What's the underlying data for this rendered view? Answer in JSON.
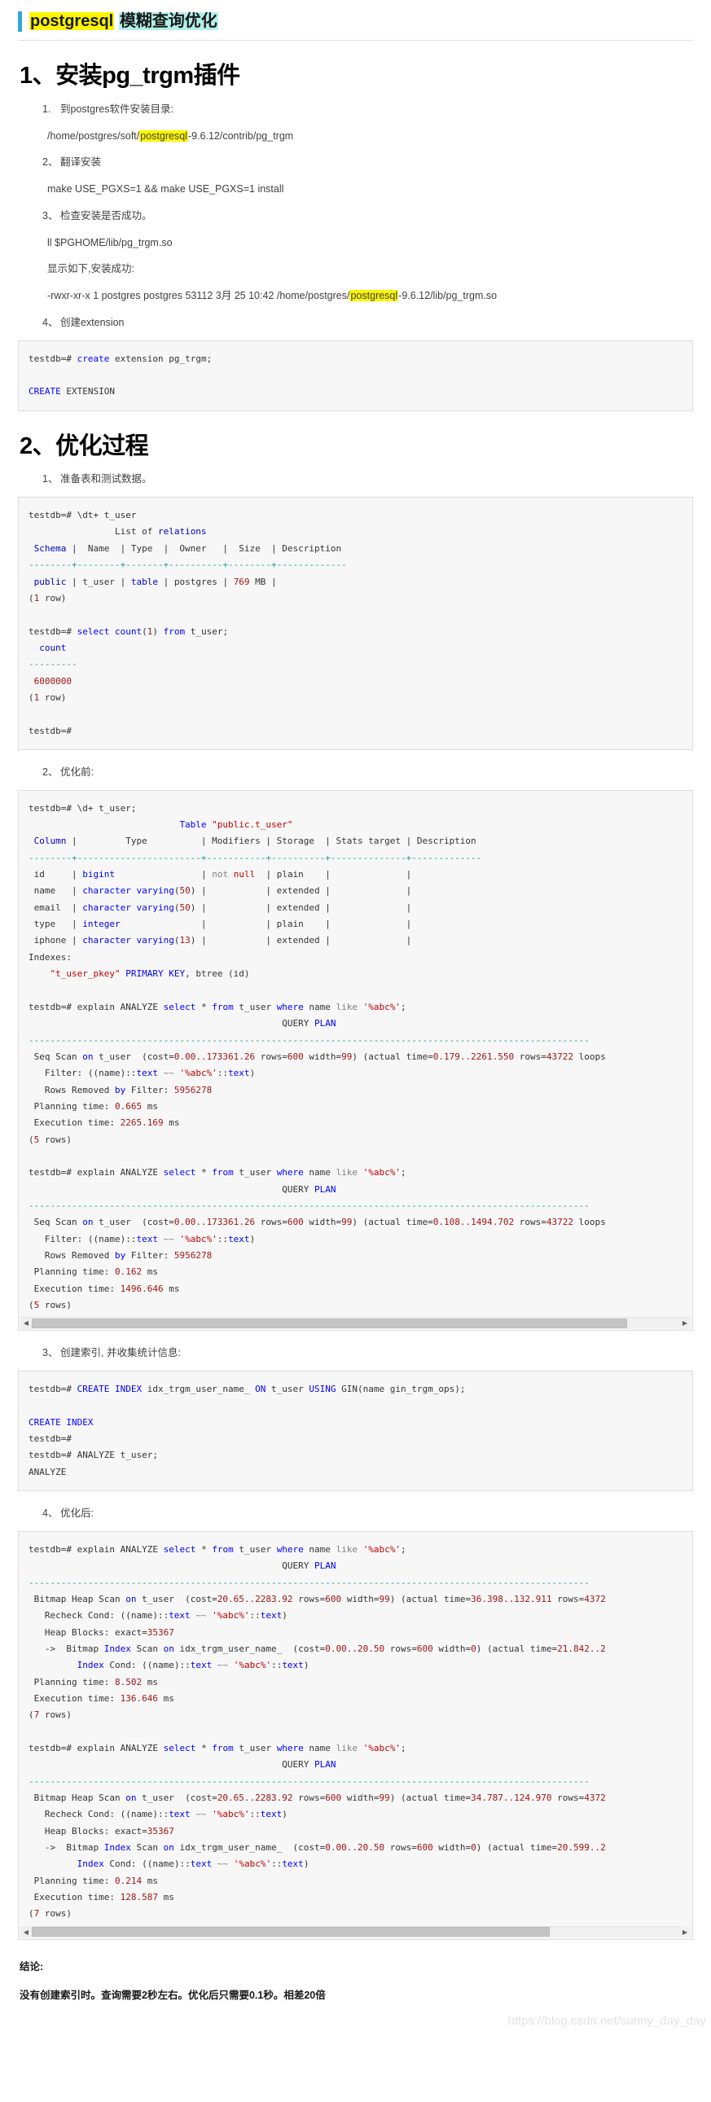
{
  "document": {
    "title_parts": {
      "highlight_yellow": "postgresql",
      "highlight_cyan": "模糊查询优化"
    },
    "accent_color": "#2fa8e0",
    "highlight_yellow_color": "#fdf500",
    "highlight_cyan_color": "#b3f0ea"
  },
  "sections": [
    {
      "heading": "1、安装pg_trgm插件",
      "steps": [
        {
          "num": "1.",
          "label": "到postgres软件安装目录:"
        },
        {
          "num": "2、",
          "label": "翻译安装"
        },
        {
          "num": "3、",
          "label": "检查安装是否成功。"
        },
        {
          "num": "4、",
          "label": "创建extension"
        }
      ],
      "detail_path_prefix": "/home/postgres/soft/",
      "detail_path_hl": "postgresql",
      "detail_path_suffix": "-9.6.12/contrib/pg_trgm",
      "detail_make": "make USE_PGXS=1  && make USE_PGXS=1 install",
      "detail_ll": "ll $PGHOME/lib/pg_trgm.so",
      "detail_show_label": "显示如下,安装成功:",
      "detail_ls_prefix": "-rwxr-xr-x 1 postgres postgres 53112 3月  25 10:42 /home/postgres/",
      "detail_ls_hl": "postgresql",
      "detail_ls_suffix": "-9.6.12/lib/pg_trgm.so"
    },
    {
      "heading": "2、优化过程",
      "steps": [
        {
          "num": "1、",
          "label": "准备表和测试数据。"
        },
        {
          "num": "2、",
          "label": "优化前:"
        },
        {
          "num": "3、",
          "label": "创建索引, 并收集统计信息:"
        },
        {
          "num": "4、",
          "label": "优化后:"
        }
      ]
    }
  ],
  "code_blocks": {
    "create_extension": [
      {
        "t": "testdb=# "
      },
      {
        "t": "create",
        "c": "kw2"
      },
      {
        "t": " extension pg_trgm;"
      },
      {
        "t": "\n\n"
      },
      {
        "t": "CREATE",
        "c": "kw2"
      },
      {
        "t": " EXTENSION"
      }
    ],
    "dt_plus": "testdb=# \\dt+ t_user\n                List of relations\n Schema |  Name  | Type  |  Owner   |  Size  | Description\n--------+--------+-------+----------+--------+-------------\n public | t_user | table | postgres | 769 MB |\n(1 row)\n\ntestdb=# select count(1) from t_user;\n  count\n---------\n 6000000\n(1 row)\n\ntestdb=#",
    "d_plus": "testdb=# \\d+ t_user;\n                            Table \"public.t_user\"\n Column |         Type          | Modifiers | Storage  | Stats target | Description\n--------+-----------------------+-----------+----------+--------------+-------------\n id     | bigint                | not null  | plain    |              |\n name   | character varying(50) |           | extended |              |\n email  | character varying(50) |           | extended |              |\n type   | integer               |           | plain    |              |\n iphone | character varying(13) |           | extended |              |\nIndexes:\n    \"t_user_pkey\" PRIMARY KEY, btree (id)",
    "explain_before_1": "testdb=# explain ANALYZE select * from t_user where name like '%abc%';\n                                               QUERY PLAN\n--------------------------------------------------------------------------------------------------------\n Seq Scan on t_user  (cost=0.00..173361.26 rows=600 width=99) (actual time=0.179..2261.550 rows=43722 loops\n   Filter: ((name)::text ~~ '%abc%'::text)\n   Rows Removed by Filter: 5956278\n Planning time: 0.665 ms\n Execution time: 2265.169 ms\n(5 rows)",
    "explain_before_2": "testdb=# explain ANALYZE select * from t_user where name like '%abc%';\n                                               QUERY PLAN\n--------------------------------------------------------------------------------------------------------\n Seq Scan on t_user  (cost=0.00..173361.26 rows=600 width=99) (actual time=0.108..1494.702 rows=43722 loops\n   Filter: ((name)::text ~~ '%abc%'::text)\n   Rows Removed by Filter: 5956278\n Planning time: 0.162 ms\n Execution time: 1496.646 ms\n(5 rows)",
    "create_index": "testdb=# CREATE INDEX idx_trgm_user_name_ ON t_user USING GIN(name gin_trgm_ops);\n\nCREATE INDEX\ntestdb=#\ntestdb=# ANALYZE t_user;\nANALYZE",
    "explain_after_1": "testdb=# explain ANALYZE select * from t_user where name like '%abc%';\n                                               QUERY PLAN\n--------------------------------------------------------------------------------------------------------\n Bitmap Heap Scan on t_user  (cost=20.65..2283.92 rows=600 width=99) (actual time=36.398..132.911 rows=4372\n   Recheck Cond: ((name)::text ~~ '%abc%'::text)\n   Heap Blocks: exact=35367\n   ->  Bitmap Index Scan on idx_trgm_user_name_  (cost=0.00..20.50 rows=600 width=0) (actual time=21.842..2\n         Index Cond: ((name)::text ~~ '%abc%'::text)\n Planning time: 8.502 ms\n Execution time: 136.646 ms\n(7 rows)",
    "explain_after_2": "testdb=# explain ANALYZE select * from t_user where name like '%abc%';\n                                               QUERY PLAN\n--------------------------------------------------------------------------------------------------------\n Bitmap Heap Scan on t_user  (cost=20.65..2283.92 rows=600 width=99) (actual time=34.787..124.970 rows=4372\n   Recheck Cond: ((name)::text ~~ '%abc%'::text)\n   Heap Blocks: exact=35367\n   ->  Bitmap Index Scan on idx_trgm_user_name_  (cost=0.00..20.50 rows=600 width=0) (actual time=20.599..2\n         Index Cond: ((name)::text ~~ '%abc%'::text)\n Planning time: 0.214 ms\n Execution time: 128.587 ms\n(7 rows)"
  },
  "conclusion": {
    "label": "结论:",
    "text": "没有创建索引时。查询需要2秒左右。优化后只需要0.1秒。相差20倍"
  },
  "watermark": "https://blog.csdn.net/sunny_day_day",
  "scrollbar": {
    "left_arrow": "◀",
    "right_arrow": "▶"
  }
}
